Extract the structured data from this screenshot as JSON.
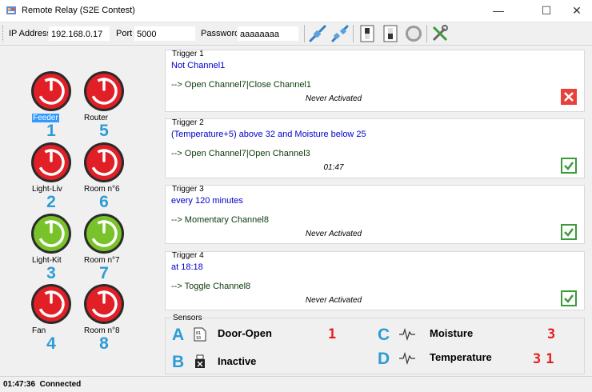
{
  "window": {
    "title": "Remote Relay (S2E Contest)",
    "minimize": "—",
    "maximize": "☐",
    "close": "✕"
  },
  "toolbar": {
    "ip_label": "IP Address",
    "ip_value": "192.168.0.17",
    "port_label": "Port",
    "port_value": "5000",
    "password_label": "Password",
    "password_value": "aaaaaaaa",
    "icons": [
      "connect-plug-icon",
      "disconnect-plug-icon",
      "switch-off-icon",
      "switch-on-icon",
      "record-icon",
      "tools-icon"
    ]
  },
  "channels": [
    {
      "label": "Feeder",
      "number": "1",
      "state": "off",
      "selected": true
    },
    {
      "label": "Router",
      "number": "5",
      "state": "off"
    },
    {
      "label": "Light-Liv",
      "number": "2",
      "state": "off"
    },
    {
      "label": "Room n°6",
      "number": "6",
      "state": "off"
    },
    {
      "label": "Light-Kit",
      "number": "3",
      "state": "on"
    },
    {
      "label": "Room n°7",
      "number": "7",
      "state": "on"
    },
    {
      "label": "Fan",
      "number": "4",
      "state": "off"
    },
    {
      "label": "Room n°8",
      "number": "8",
      "state": "off"
    }
  ],
  "triggers": [
    {
      "title": "Trigger 1",
      "condition": "Not Channel1",
      "action": "--> Open Channel7|Close Channel1",
      "status": "Never Activated",
      "enabled": false
    },
    {
      "title": "Trigger 2",
      "condition": "(Temperature+5) above 32 and Moisture below 25",
      "action": "--> Open Channel7|Open Channel3",
      "status": "01:47",
      "enabled": true
    },
    {
      "title": "Trigger 3",
      "condition": "every 120 minutes",
      "action": "--> Momentary Channel8",
      "status": "Never Activated",
      "enabled": true
    },
    {
      "title": "Trigger 4",
      "condition": "at 18:18",
      "action": "--> Toggle Channel8",
      "status": "Never Activated",
      "enabled": true
    }
  ],
  "sensors": {
    "title": "Sensors",
    "items": [
      {
        "letter": "A",
        "icon": "digital-sensor-icon",
        "name": "Door-Open",
        "value": "1"
      },
      {
        "letter": "B",
        "icon": "usb-disconnected-icon",
        "name": "Inactive",
        "value": ""
      },
      {
        "letter": "C",
        "icon": "analog-wave-icon",
        "name": "Moisture",
        "value": "3"
      },
      {
        "letter": "D",
        "icon": "analog-wave-icon",
        "name": "Temperature",
        "value": "31"
      }
    ]
  },
  "status": {
    "time": "01:47:36",
    "text": "Connected"
  },
  "colors": {
    "off": "#e01f26",
    "on": "#78c22a",
    "accent": "#2e9bd6",
    "condition": "#0000cc",
    "digit": "#e81c1c"
  }
}
